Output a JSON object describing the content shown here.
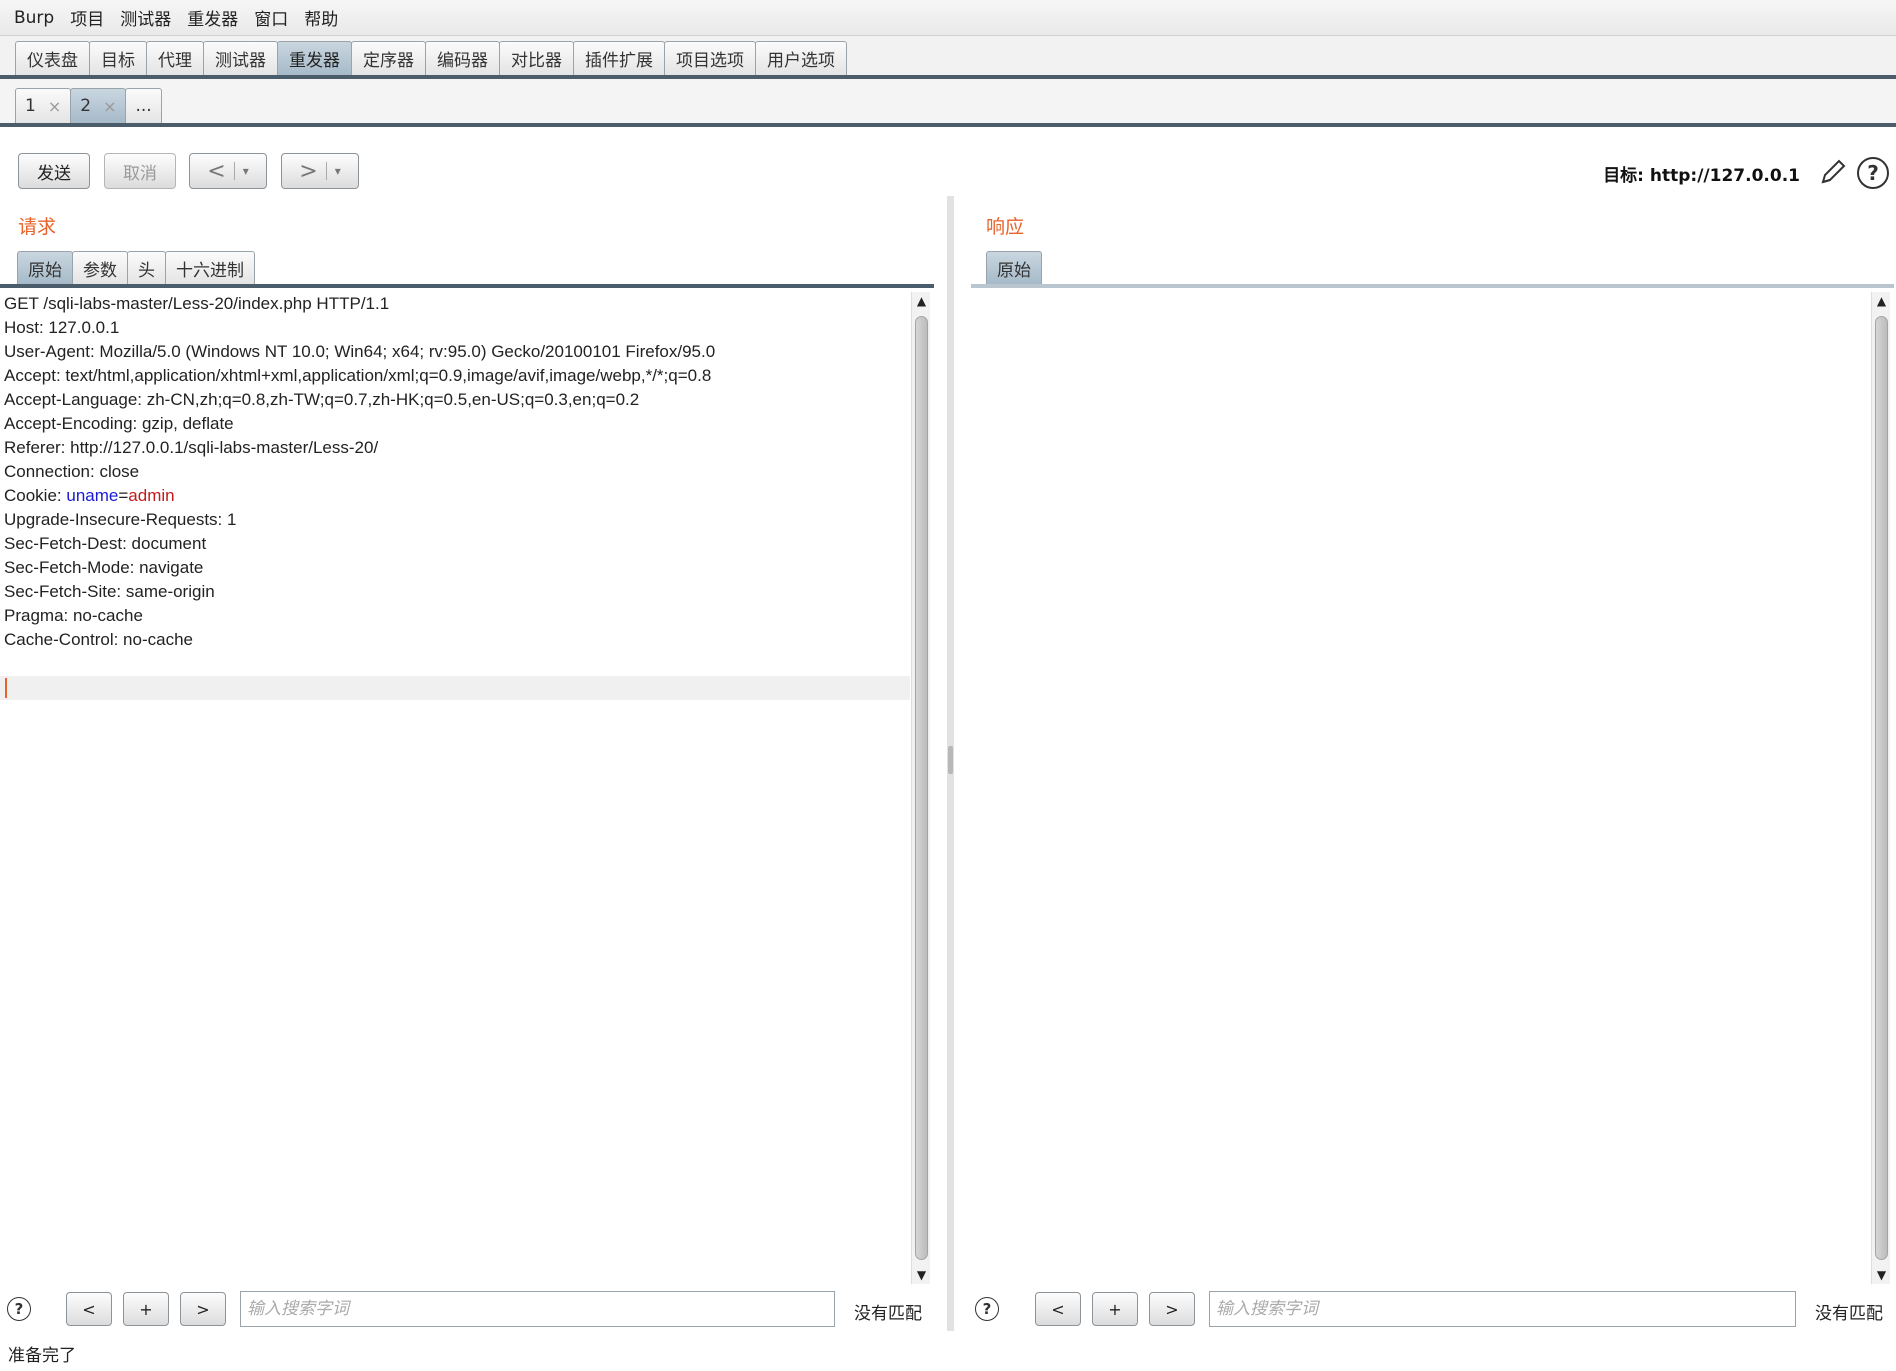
{
  "menu": [
    "Burp",
    "项目",
    "测试器",
    "重发器",
    "窗口",
    "帮助"
  ],
  "main_tabs": [
    "仪表盘",
    "目标",
    "代理",
    "测试器",
    "重发器",
    "定序器",
    "编码器",
    "对比器",
    "插件扩展",
    "项目选项",
    "用户选项"
  ],
  "main_tab_active": "重发器",
  "sub_tabs": [
    {
      "label": "1",
      "close": "×"
    },
    {
      "label": "2",
      "close": "×"
    },
    {
      "label": "..."
    }
  ],
  "toolbar": {
    "send": "发送",
    "cancel": "取消",
    "back": "<",
    "forward": ">",
    "dropdown": "▾",
    "target_label": "目标: http://127.0.0.1",
    "help": "?"
  },
  "request": {
    "title": "请求",
    "tabs": [
      "原始",
      "参数",
      "头",
      "十六进制"
    ],
    "lines": [
      "GET /sqli-labs-master/Less-20/index.php HTTP/1.1",
      "Host: 127.0.0.1",
      "User-Agent: Mozilla/5.0 (Windows NT 10.0; Win64; x64; rv:95.0) Gecko/20100101 Firefox/95.0",
      "Accept: text/html,application/xhtml+xml,application/xml;q=0.9,image/avif,image/webp,*/*;q=0.8",
      "Accept-Language: zh-CN,zh;q=0.8,zh-TW;q=0.7,zh-HK;q=0.5,en-US;q=0.3,en;q=0.2",
      "Accept-Encoding: gzip, deflate",
      "Referer: http://127.0.0.1/sqli-labs-master/Less-20/",
      "Connection: close"
    ],
    "cookie": {
      "prefix": "Cookie: ",
      "name": "uname",
      "eq": "=",
      "value": "admin"
    },
    "lines_after": [
      "Upgrade-Insecure-Requests: 1",
      "Sec-Fetch-Dest: document",
      "Sec-Fetch-Mode: navigate",
      "Sec-Fetch-Site: same-origin",
      "Pragma: no-cache",
      "Cache-Control: no-cache"
    ]
  },
  "response": {
    "title": "响应",
    "tabs": [
      "原始"
    ]
  },
  "search": {
    "help": "?",
    "prev": "<",
    "add": "+",
    "next": ">",
    "placeholder": "输入搜索字词",
    "status": "没有匹配"
  },
  "status_bar": "准备完了",
  "colors": {
    "accent": "#e8632b",
    "tab_active": "#a6bac9",
    "tab_border": "#4b5d6b",
    "cookie_name": "#1a1ad6",
    "cookie_value": "#c21a1a"
  }
}
